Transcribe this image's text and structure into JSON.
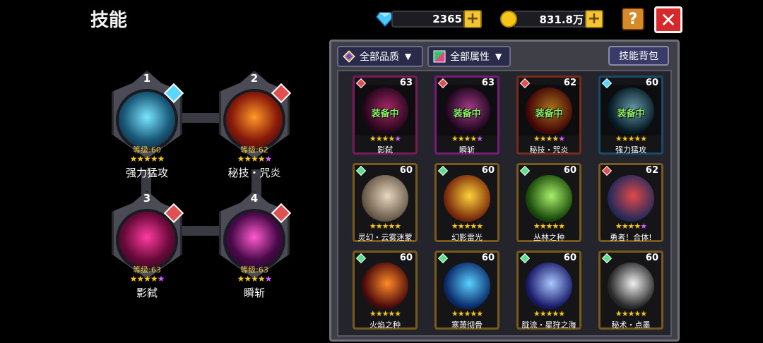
{
  "header": {
    "title": "技能"
  },
  "currency": {
    "gems": "2365",
    "gold": "831.8万",
    "plus": "+"
  },
  "buttons": {
    "help": "?",
    "close": "✕"
  },
  "equipped": [
    {
      "num": "1",
      "level": "等级:60",
      "name": "强力猛攻",
      "stars": "★★★★★",
      "purple": "",
      "orb": "#1a5a7a",
      "glow": "#7ae6ff",
      "badge": "#5ad6ff"
    },
    {
      "num": "2",
      "level": "等级:62",
      "name": "秘技・咒炎",
      "stars": "★★★★",
      "purple": "★",
      "orb": "#8a1a0a",
      "glow": "#ff9a2a",
      "badge": "#e05050"
    },
    {
      "num": "3",
      "level": "等级:63",
      "name": "影弑",
      "stars": "★★★★",
      "purple": "★",
      "orb": "#6a0a3a",
      "glow": "#ff3aa0",
      "badge": "#e05050"
    },
    {
      "num": "4",
      "level": "等级:63",
      "name": "瞬斩",
      "stars": "★★★★",
      "purple": "★",
      "orb": "#4a0a4a",
      "glow": "#ff5ad0",
      "badge": "#e05050"
    }
  ],
  "filters": {
    "quality": "全部品质",
    "attribute": "全部属性",
    "dropdown": "▼",
    "bag": "技能背包"
  },
  "cards": [
    {
      "level": "63",
      "name": "影弑",
      "equipped": "装备中",
      "stars": "★★★★",
      "purple": "★",
      "border": "#7a1a5a",
      "gem": "#e05050",
      "c1": "#ff3aa0",
      "c2": "#3a0a2a"
    },
    {
      "level": "63",
      "name": "瞬斩",
      "equipped": "装备中",
      "stars": "★★★★",
      "purple": "★",
      "border": "#7a1a7a",
      "gem": "#e05050",
      "c1": "#ff5ad0",
      "c2": "#2a0a2a"
    },
    {
      "level": "62",
      "name": "秘技・咒炎",
      "equipped": "装备中",
      "stars": "★★★★",
      "purple": "★",
      "border": "#7a2a1a",
      "gem": "#e05050",
      "c1": "#ffb02a",
      "c2": "#6a0a0a"
    },
    {
      "level": "60",
      "name": "强力猛攻",
      "equipped": "装备中",
      "stars": "★★★★★",
      "purple": "",
      "border": "#1a4a6a",
      "gem": "#5ad6ff",
      "c1": "#9ae8ff",
      "c2": "#0a2a3a"
    },
    {
      "level": "60",
      "name": "灵幻・云雾迷蒙",
      "equipped": "",
      "stars": "★★★★★",
      "purple": "",
      "border": "#7a5a1a",
      "gem": "#5ae08a",
      "c1": "#e8d8c0",
      "c2": "#6a5a4a"
    },
    {
      "level": "60",
      "name": "幻影雷光",
      "equipped": "",
      "stars": "★★★★★",
      "purple": "",
      "border": "#7a5a1a",
      "gem": "#5ae08a",
      "c1": "#ffd23a",
      "c2": "#7a2a0a"
    },
    {
      "level": "60",
      "name": "丛林之种",
      "equipped": "",
      "stars": "★★★★★",
      "purple": "",
      "border": "#7a5a1a",
      "gem": "#5ae08a",
      "c1": "#a8f06a",
      "c2": "#1a4a0a"
    },
    {
      "level": "62",
      "name": "勇者！合体!",
      "equipped": "",
      "stars": "★★★★",
      "purple": "★",
      "border": "#7a5a1a",
      "gem": "#e05050",
      "c1": "#e04a4a",
      "c2": "#2a2a5a"
    },
    {
      "level": "60",
      "name": "火焰之种",
      "equipped": "",
      "stars": "★★★★★",
      "purple": "",
      "border": "#7a5a1a",
      "gem": "#5ae08a",
      "c1": "#ff8a2a",
      "c2": "#4a0a0a"
    },
    {
      "level": "60",
      "name": "寒萧彻骨",
      "equipped": "",
      "stars": "★★★★★",
      "purple": "",
      "border": "#7a5a1a",
      "gem": "#5ae08a",
      "c1": "#5ad0ff",
      "c2": "#0a2a6a"
    },
    {
      "level": "60",
      "name": "胧流・星狩之海",
      "equipped": "",
      "stars": "★★★★★",
      "purple": "",
      "border": "#7a5a1a",
      "gem": "#5ae08a",
      "c1": "#a8c8ff",
      "c2": "#1a1a6a"
    },
    {
      "level": "60",
      "name": "秘术・点墨",
      "equipped": "",
      "stars": "★★★★★",
      "purple": "",
      "border": "#7a5a1a",
      "gem": "#5ae08a",
      "c1": "#f0f0f0",
      "c2": "#2a2a2a"
    }
  ]
}
